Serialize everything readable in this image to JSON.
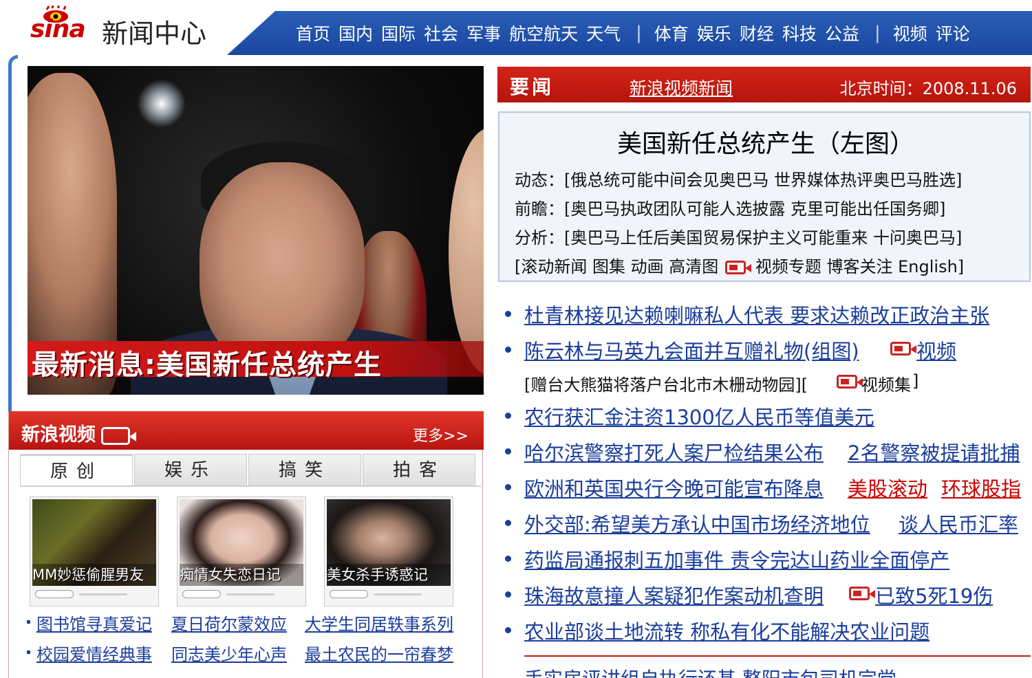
{
  "header": {
    "logo_text": "sina",
    "logo_subtitle": "新闻中心",
    "nav_group_1": [
      "首页",
      "国内",
      "国际",
      "社会",
      "军事",
      "航空航天",
      "天气"
    ],
    "nav_group_2": [
      "体育",
      "娱乐",
      "财经",
      "科技",
      "公益"
    ],
    "nav_group_3": [
      "视频",
      "评论"
    ],
    "separator": "|",
    "colors": {
      "nav_bg": "#1a46a0",
      "brand_red": "#cc0000"
    }
  },
  "hero": {
    "caption": "最新消息:美国新任总统产生"
  },
  "video": {
    "title": "新浪视频",
    "more": "更多>>",
    "tabs": [
      "原创",
      "娱乐",
      "搞笑",
      "拍客"
    ],
    "active_tab": "原创",
    "thumbs": [
      {
        "caption": "MM妙惩偷腥男友"
      },
      {
        "caption": "痴情女失恋日记"
      },
      {
        "caption": "美女杀手诱惑记"
      }
    ],
    "links_row1": [
      "图书馆寻真爱记",
      "夏日荷尔蒙效应",
      "大学生同居轶事系列"
    ],
    "links_row2": [
      "校园爱情经典事",
      "同志美少年心声",
      "最土农民的一帘春梦"
    ]
  },
  "news": {
    "header_title": "要闻",
    "header_link": "新浪视频新闻",
    "time_label": "北京时间：2008.11.06",
    "headline": {
      "title": "美国新任总统产生（左图）",
      "lines": [
        "动态：[俄总统可能中间会见奥巴马  世界媒体热评奥巴马胜选]",
        "前瞻：[奥巴马执政团队可能人选披露  克里可能出任国务卿]",
        "分析：[奥巴马上任后美国贸易保护主义可能重来  十问奥巴马]"
      ],
      "tools_prefix": "[滚动新闻  图集  动画  高清图 ",
      "tools_suffix": "视频专题  博客关注  English]"
    },
    "items": [
      {
        "text": "杜青林接见达赖喇嘛私人代表  要求达赖改正政治主张"
      },
      {
        "text": "陈云林与马英九会面并互赠礼物(组图)",
        "video": "视频"
      },
      {
        "sub_prefix": "[赠台大熊猫将落户台北市木栅动物园][",
        "sub_video": "视频集",
        "sub_suffix": "]"
      },
      {
        "text": "农行获汇金注资1300亿人民币等值美元"
      },
      {
        "text": "哈尔滨警察打死人案尸检结果公布",
        "extra": "2名警察被提请批捕"
      },
      {
        "text": "欧洲和英国央行今晚可能宣布降息",
        "red1": "美股滚动",
        "red2": "环球股指"
      },
      {
        "text": "外交部:希望美方承认中国市场经济地位",
        "extra": "谈人民币汇率"
      },
      {
        "text": "药监局通报刺五加事件  责令完达山药业全面停产"
      },
      {
        "text": "珠海故意撞人案疑犯作案动机查明",
        "video": "已致5死19伤"
      },
      {
        "text": "农业部谈土地流转  称私有化不能解决农业问题"
      }
    ],
    "cut_text": "手实房评讲组自执行还基   整阳市包司机完党"
  }
}
